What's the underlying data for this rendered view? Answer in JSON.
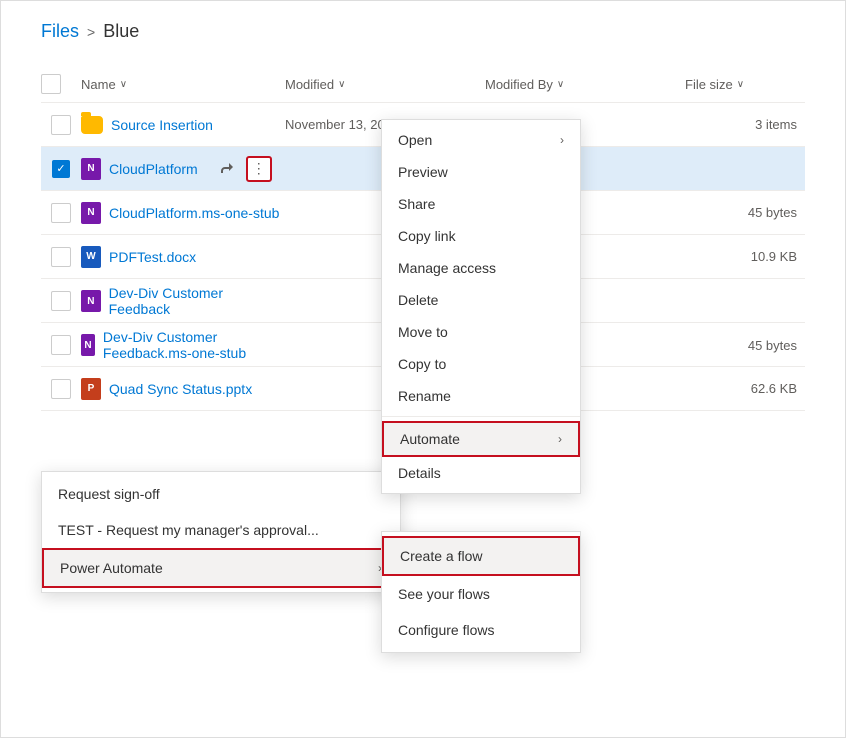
{
  "breadcrumb": {
    "files_label": "Files",
    "separator": ">",
    "current": "Blue"
  },
  "table": {
    "headers": {
      "name": "Name",
      "modified": "Modified",
      "modified_by": "Modified By",
      "file_size": "File size"
    },
    "rows": [
      {
        "id": "source-insertion",
        "name": "Source Insertion",
        "type": "folder",
        "modified": "November 13, 2012",
        "modified_by": "",
        "file_size": "3 items",
        "selected": false
      },
      {
        "id": "cloud-platform",
        "name": "CloudPlatform",
        "type": "onenote",
        "modified": "",
        "modified_by": "",
        "file_size": "",
        "selected": true
      },
      {
        "id": "cloudplatform-stub",
        "name": "CloudPlatform.ms-one-stub",
        "type": "onenote",
        "modified": "",
        "modified_by": "",
        "file_size": "45 bytes",
        "selected": false
      },
      {
        "id": "pdftest",
        "name": "PDFTest.docx",
        "type": "word",
        "modified": "",
        "modified_by": "",
        "file_size": "10.9 KB",
        "selected": false
      },
      {
        "id": "dev-div-feedback",
        "name": "Dev-Div Customer Feedback",
        "type": "onenote",
        "modified": "",
        "modified_by": "",
        "file_size": "",
        "selected": false
      },
      {
        "id": "dev-div-feedback-stub",
        "name": "Dev-Div Customer Feedback.ms-one-stub",
        "type": "onenote",
        "modified": "",
        "modified_by": "",
        "file_size": "45 bytes",
        "selected": false
      },
      {
        "id": "quad-sync",
        "name": "Quad Sync Status.pptx",
        "type": "pptx",
        "modified": "",
        "modified_by": "",
        "file_size": "62.6 KB",
        "selected": false
      }
    ]
  },
  "context_menu": {
    "items": [
      {
        "label": "Open",
        "has_submenu": true
      },
      {
        "label": "Preview",
        "has_submenu": false
      },
      {
        "label": "Share",
        "has_submenu": false
      },
      {
        "label": "Copy link",
        "has_submenu": false
      },
      {
        "label": "Manage access",
        "has_submenu": false
      },
      {
        "label": "Delete",
        "has_submenu": false
      },
      {
        "label": "Move to",
        "has_submenu": false
      },
      {
        "label": "Copy to",
        "has_submenu": false
      },
      {
        "label": "Rename",
        "has_submenu": false
      },
      {
        "label": "Automate",
        "has_submenu": true,
        "highlighted": true
      },
      {
        "label": "Details",
        "has_submenu": false
      }
    ]
  },
  "left_menu": {
    "items": [
      {
        "label": "Request sign-off",
        "has_submenu": false
      },
      {
        "label": "TEST - Request my manager's approval...",
        "has_submenu": false
      },
      {
        "label": "Power Automate",
        "has_submenu": true,
        "highlighted": true
      }
    ]
  },
  "right_submenu": {
    "items": [
      {
        "label": "Create a flow",
        "highlighted": true
      },
      {
        "label": "See your flows",
        "highlighted": false
      },
      {
        "label": "Configure flows",
        "highlighted": false
      }
    ]
  }
}
